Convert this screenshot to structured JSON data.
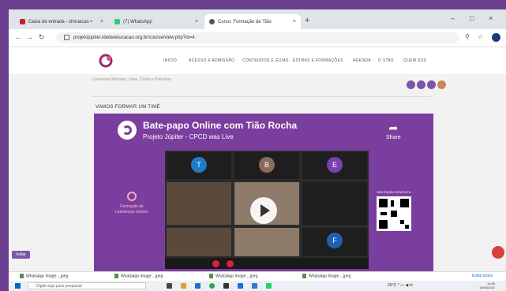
{
  "browser": {
    "tabs": [
      {
        "label": "Caixa de entrada - chiruacas •",
        "color": "#c5221f",
        "active": false
      },
      {
        "label": "(7) WhatsApp",
        "color": "#25d366",
        "active": false
      },
      {
        "label": "Curso: Formação de Tião",
        "color": "#555555",
        "active": true
      }
    ],
    "new_tab": "+",
    "url": "projetojupiter.idedeeducacao.org.br/course/view.php?id=4",
    "window_controls": [
      "–",
      "□",
      "×"
    ]
  },
  "site": {
    "menu": [
      "INÍCIO",
      "ACESSO E ADMISSÃO",
      "CONTEÚDOS E GUIAS",
      "ESTRAS E FORMAÇÕES",
      "AGENDA",
      "O STAS",
      "QUEM SOU"
    ],
    "breadline": "Conversas Mensais, Lives, Ciclos e Palestras",
    "section_title": "VAMOS FORMAR UM TIMÉ"
  },
  "video": {
    "title": "Bate-papo Online com Tião Rocha",
    "subtitle": "Projeto Júpiter - CPCD was Live",
    "share_label": "Share",
    "participants": [
      "T",
      "B",
      "E",
      "F"
    ],
    "side_brand": "Formação de Lideranças Jovens",
    "qr_label": "INSCRIÇÃO GRATUITA",
    "participant_colors": [
      "#1f7bc4",
      "#8a6a5a",
      "#7b3fb0",
      "#1f5fb4"
    ]
  },
  "page": {
    "side_button": "Voltar"
  },
  "downloads": {
    "items": [
      "WhatsApp Image....jpeg",
      "WhatsApp Image....jpeg",
      "WhatsApp Image....jpeg",
      "WhatsApp Image....jpeg"
    ],
    "show_all": "Exibir todos"
  },
  "taskbar": {
    "search_placeholder": "Digite aqui para pesquisar",
    "weather": "26°C",
    "time": "10:05",
    "date": "18/06/2021"
  }
}
